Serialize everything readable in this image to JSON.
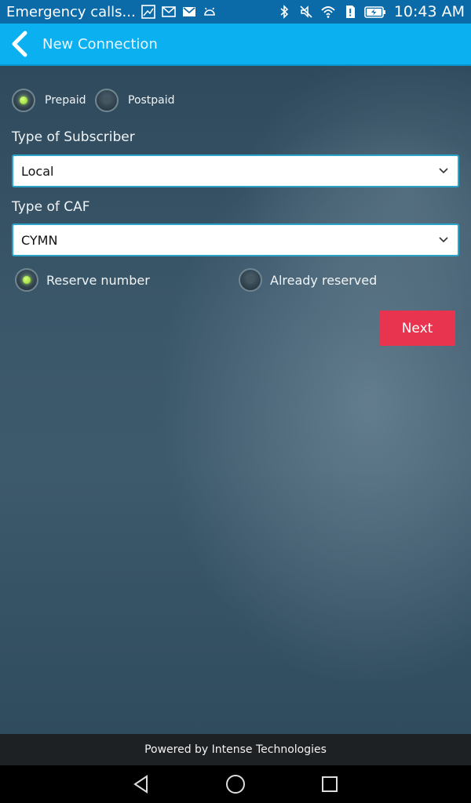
{
  "status_bar": {
    "notification_text": "Emergency calls...",
    "time": "10:43 AM",
    "icons_left": [
      "gallery-icon",
      "email-icon",
      "gmail-icon",
      "android-icon"
    ],
    "icons_right": [
      "bluetooth-icon",
      "mute-icon",
      "wifi-icon",
      "sim-alert-icon",
      "battery-charging-icon"
    ]
  },
  "app_bar": {
    "title": "New Connection",
    "color": "#0ab0f0"
  },
  "connection_type": {
    "options": [
      {
        "label": "Prepaid",
        "selected": true
      },
      {
        "label": "Postpaid",
        "selected": false
      }
    ]
  },
  "subscriber": {
    "label": "Type of Subscriber",
    "value": "Local"
  },
  "caf": {
    "label": "Type of CAF",
    "value": "CYMN"
  },
  "number_option": {
    "options": [
      {
        "label": "Reserve number",
        "selected": true
      },
      {
        "label": "Already reserved",
        "selected": false
      }
    ]
  },
  "actions": {
    "next_label": "Next",
    "next_color": "#e8344f"
  },
  "footer": {
    "text": "Powered by Intense Technologies"
  },
  "nav_bar": {
    "buttons": [
      "back-nav-icon",
      "home-nav-icon",
      "recents-nav-icon"
    ]
  }
}
